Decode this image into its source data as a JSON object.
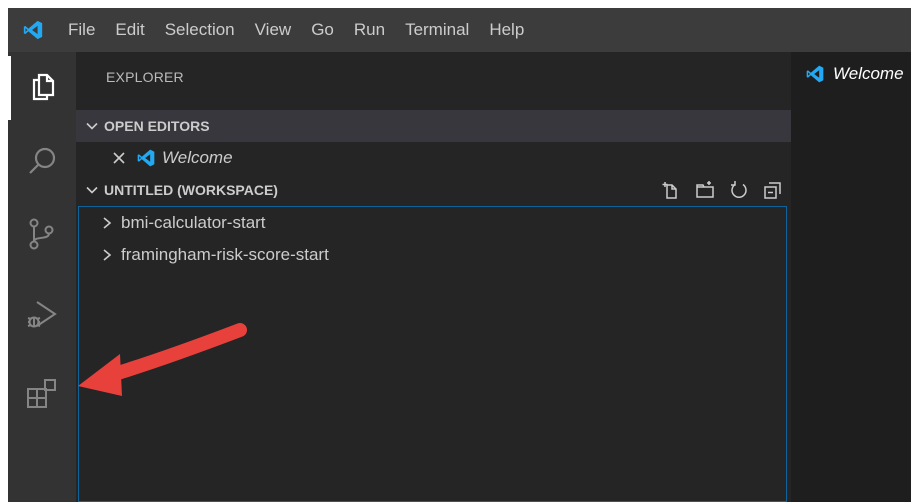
{
  "menu": {
    "items": [
      "File",
      "Edit",
      "Selection",
      "View",
      "Go",
      "Run",
      "Terminal",
      "Help"
    ]
  },
  "activity_bar": {
    "items": [
      {
        "icon": "files-icon",
        "active": true
      },
      {
        "icon": "search-icon",
        "active": false
      },
      {
        "icon": "source-control-icon",
        "active": false
      },
      {
        "icon": "run-debug-icon",
        "active": false
      },
      {
        "icon": "extensions-icon",
        "active": false
      }
    ]
  },
  "sidebar": {
    "title": "EXPLORER",
    "open_editors": {
      "label": "OPEN EDITORS",
      "items": [
        {
          "label": "Welcome"
        }
      ]
    },
    "workspace": {
      "label": "UNTITLED (WORKSPACE)",
      "actions": [
        "new-file-icon",
        "new-folder-icon",
        "refresh-icon",
        "collapse-all-icon"
      ],
      "items": [
        {
          "label": "bmi-calculator-start"
        },
        {
          "label": "framingham-risk-score-start"
        }
      ]
    }
  },
  "editor": {
    "tab_label": "Welcome"
  },
  "colors": {
    "vscode_blue": "#23a9f2",
    "arrow_red": "#e8413c",
    "focus_border": "#0e639c"
  }
}
